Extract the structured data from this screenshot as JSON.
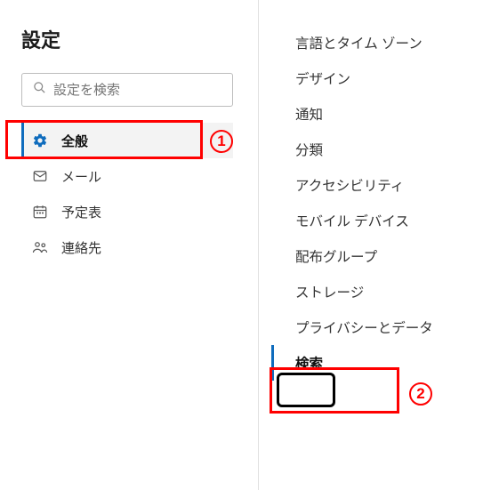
{
  "sidebar": {
    "title": "設定",
    "search_placeholder": "設定を検索",
    "items": [
      {
        "label": "全般",
        "icon": "gear-icon",
        "active": true
      },
      {
        "label": "メール",
        "icon": "mail-icon",
        "active": false
      },
      {
        "label": "予定表",
        "icon": "calendar-icon",
        "active": false
      },
      {
        "label": "連絡先",
        "icon": "people-icon",
        "active": false
      }
    ]
  },
  "content": {
    "items": [
      {
        "label": "言語とタイム ゾーン",
        "active": false
      },
      {
        "label": "デザイン",
        "active": false
      },
      {
        "label": "通知",
        "active": false
      },
      {
        "label": "分類",
        "active": false
      },
      {
        "label": "アクセシビリティ",
        "active": false
      },
      {
        "label": "モバイル デバイス",
        "active": false
      },
      {
        "label": "配布グループ",
        "active": false
      },
      {
        "label": "ストレージ",
        "active": false
      },
      {
        "label": "プライバシーとデータ",
        "active": false
      },
      {
        "label": "検索",
        "active": true
      }
    ]
  },
  "callouts": {
    "one": "1",
    "two": "2"
  }
}
